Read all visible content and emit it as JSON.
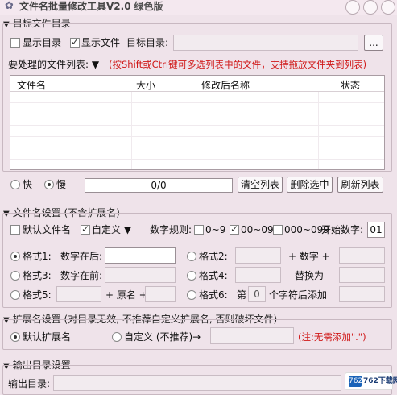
{
  "window": {
    "title": "文件名批量修改工具V2.0",
    "edition": "绿色版"
  },
  "target_dir": {
    "section_title": "目标文件目录",
    "show_dirs_label": "显示目录",
    "show_files_label": "显示文件",
    "target_label": "目标目录:",
    "path_value": "",
    "browse_label": "..."
  },
  "file_list": {
    "label": "要处理的文件列表: ▼",
    "hint": "(按Shift或Ctrl键可多选列表中的文件，支持拖放文件夹到列表)",
    "columns": [
      "文件名",
      "大小",
      "修改后名称",
      "状态"
    ]
  },
  "controls": {
    "fast_label": "快",
    "slow_label": "慢",
    "progress_text": "0/0",
    "clear_label": "清空列表",
    "delete_label": "删除选中",
    "refresh_label": "刷新列表"
  },
  "filename_settings": {
    "section_title": "文件名设置 (不含扩展名)",
    "default_name_label": "默认文件名",
    "custom_label": "自定义 ▼",
    "number_rule_label": "数字规则:",
    "rule_0_9": "0~9",
    "rule_00_09": "00~09",
    "rule_000_099": "000~099",
    "start_number_label": "开始数字:",
    "start_number_value": "01",
    "format1_label": "格式1:",
    "format1_desc": "数字在后:",
    "format2_label": "格式2:",
    "plus_number": "+ 数字 +",
    "format3_label": "格式3:",
    "format3_desc": "数字在前:",
    "format4_label": "格式4:",
    "replace_label": "替换为",
    "format5_label": "格式5:",
    "plus_original": "+ 原名 +",
    "format6_label": "格式6:",
    "nth_label": "第",
    "nth_value": "0",
    "after_char_label": "个字符后添加"
  },
  "ext_settings": {
    "section_title": "扩展名设置 (对目录无效, 不推荐自定义扩展名, 否则破坏文件)",
    "default_ext_label": "默认扩展名",
    "custom_ext_label": "自定义 (不推荐)→",
    "note": "(注:无需添加\".\")"
  },
  "output": {
    "section_title": "输出目录设置",
    "dir_label": "输出目录:"
  },
  "watermark": {
    "icon_text": "762",
    "text": "762下载网"
  },
  "colors": {
    "background": "#efe3ea",
    "hint_red": "#d01818"
  }
}
